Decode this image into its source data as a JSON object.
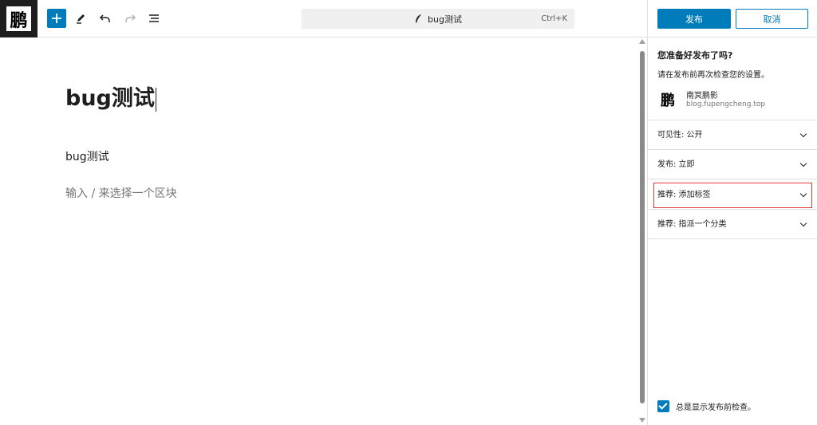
{
  "site_logo": {
    "glyph": "鹏"
  },
  "toolbar": {
    "inserter_icon": "plus-icon",
    "tools_icon": "pencil-icon",
    "undo_icon": "undo-icon",
    "redo_icon": "redo-icon",
    "outline_icon": "list-view-icon"
  },
  "command_bar": {
    "title": "bug测试",
    "shortcut": "Ctrl+K",
    "icon": "feather-icon"
  },
  "editor": {
    "title": "bug测试",
    "paragraph": "bug测试",
    "placeholder": "输入 / 来选择一个区块"
  },
  "sidebar": {
    "publish_label": "发布",
    "cancel_label": "取消",
    "prepublish_title": "您准备好发布了吗?",
    "prepublish_desc": "请在发布前再次检查您的设置。",
    "site": {
      "icon_glyph": "鹏",
      "name": "南冥鹏影",
      "url": "blog.fupengcheng.top"
    },
    "panels": [
      {
        "label": "可见性:  公开"
      },
      {
        "label": "发布:  立即"
      },
      {
        "label": "推荐:  添加标签"
      },
      {
        "label": "推荐:  指派一个分类"
      }
    ],
    "always_check_label": "总是显示发布前检查。"
  },
  "colors": {
    "accent": "#007cba",
    "highlight": "#e03a3a"
  }
}
